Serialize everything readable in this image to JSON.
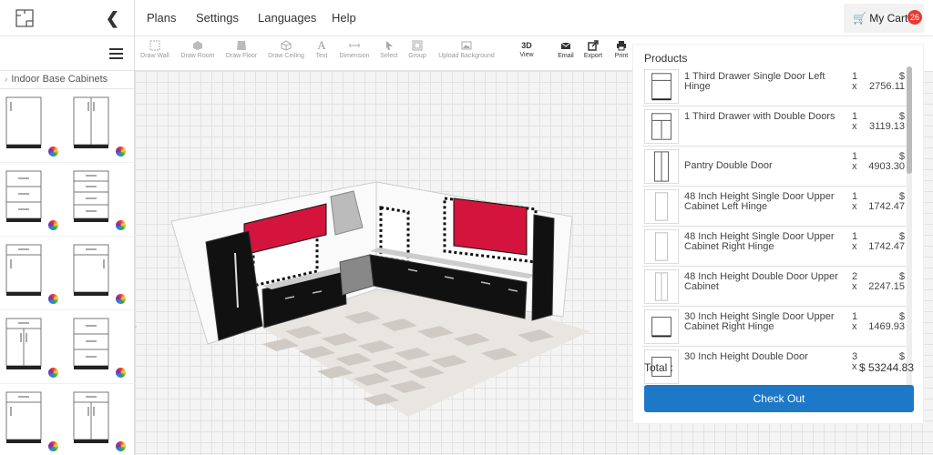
{
  "app": {
    "logo_name": "floorplan-logo"
  },
  "nav": {
    "items": [
      {
        "label": "Plans"
      },
      {
        "label": "Settings"
      },
      {
        "label": "Languages"
      },
      {
        "label": "Help"
      }
    ],
    "cart_label": "My Cart",
    "cart_count": "26"
  },
  "toolbar": {
    "tools": [
      {
        "label": "Draw Wall",
        "icon": "wall-icon"
      },
      {
        "label": "Draw Room",
        "icon": "room-icon"
      },
      {
        "label": "Draw Floor",
        "icon": "floor-icon"
      },
      {
        "label": "Draw Ceiling",
        "icon": "ceiling-icon"
      },
      {
        "label": "Text",
        "icon": "text-icon"
      },
      {
        "label": "Dimension",
        "icon": "dimension-icon"
      },
      {
        "label": "Select",
        "icon": "select-icon"
      },
      {
        "label": "Group",
        "icon": "group-icon"
      },
      {
        "label": "Upload Background",
        "icon": "image-icon"
      }
    ],
    "actions": [
      {
        "label": "View",
        "top": "3D"
      },
      {
        "label": "Email",
        "icon": "email-icon"
      },
      {
        "label": "Export",
        "icon": "export-icon"
      },
      {
        "label": "Print",
        "icon": "print-icon"
      }
    ]
  },
  "sidebar": {
    "category": "Indoor Base Cabinets"
  },
  "products": {
    "title": "Products",
    "items": [
      {
        "name": "1 Third Drawer Single Door Left Hinge",
        "qty": "1",
        "price": "2756.11"
      },
      {
        "name": "1 Third Drawer with Double Doors",
        "qty": "1",
        "price": "3119.13"
      },
      {
        "name": "Pantry Double Door",
        "qty": "1",
        "price": "4903.30"
      },
      {
        "name": "48 Inch Height Single Door Upper Cabinet Left Hinge",
        "qty": "1",
        "price": "1742.47"
      },
      {
        "name": "48 Inch Height Single Door Upper Cabinet Right Hinge",
        "qty": "1",
        "price": "1742.47"
      },
      {
        "name": "48 Inch Height Double Door Upper Cabinet",
        "qty": "2",
        "price": "2247.15"
      },
      {
        "name": "30 Inch Height Single Door Upper Cabinet Right Hinge",
        "qty": "1",
        "price": "1469.93"
      },
      {
        "name": "30 Inch Height Double Door",
        "qty": "3",
        "price": ""
      }
    ],
    "qty_prefix": "x",
    "currency": "$",
    "total_label": "Total :",
    "total_value": "$ 53244.83",
    "checkout_label": "Check Out"
  },
  "colors": {
    "accent": "#1e78c8",
    "badge": "#e53935",
    "cabinet": "#111111",
    "upper_red": "#d4143c"
  }
}
